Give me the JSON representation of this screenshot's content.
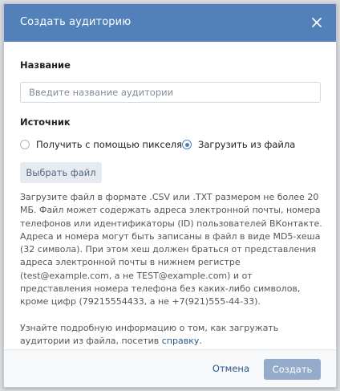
{
  "dialog": {
    "title": "Создать аудиторию",
    "close_icon": "close-icon"
  },
  "form": {
    "name_label": "Название",
    "name_placeholder": "Введите название аудитории",
    "name_value": "",
    "source_label": "Источник",
    "source_options": [
      {
        "label": "Получить с помощью пикселя",
        "checked": false
      },
      {
        "label": "Загрузить из файла",
        "checked": true
      }
    ],
    "choose_file_label": "Выбрать файл",
    "description": "Загрузите файл в формате .CSV или .TXT размером не более 20 МБ. Файл может содержать адреса электронной почты, номера телефонов или идентификаторы (ID) пользователей ВКонтакте. Адреса и номера могут быть записаны в файл в виде MD5-хеша (32 символа). При этом хеш должен браться от представления адреса электронной почты в нижнем регистре (test@example.com, а не TEST@example.com) и от представления номера телефона без каких-либо символов, кроме цифр (79215554433, а не +7(921)555-44-33).",
    "more_info_text": "Узнайте подробную информацию о том, как загружать аудитории из файла, посетив",
    "more_info_link": "справку",
    "more_info_end": "."
  },
  "footer": {
    "cancel_label": "Отмена",
    "create_label": "Создать"
  },
  "colors": {
    "header": "#5181b8",
    "link": "#2a5885",
    "primary_disabled": "#94acca"
  }
}
